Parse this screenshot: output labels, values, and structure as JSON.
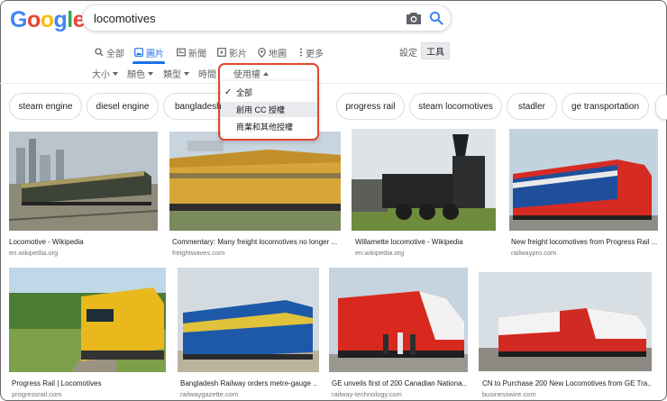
{
  "logo": "Google",
  "search": {
    "query": "locomotives"
  },
  "tabs": [
    {
      "label": "全部"
    },
    {
      "label": "圖片"
    },
    {
      "label": "新聞"
    },
    {
      "label": "影片"
    },
    {
      "label": "地圖"
    },
    {
      "label": "更多"
    }
  ],
  "settings_label": "設定",
  "tools_label": "工具",
  "filters": [
    {
      "label": "大小"
    },
    {
      "label": "顏色"
    },
    {
      "label": "類型"
    },
    {
      "label": "時間"
    },
    {
      "label": "使用權"
    }
  ],
  "usage_menu": [
    {
      "label": "全部",
      "checked": true
    },
    {
      "label": "創用 CC 授權",
      "highlighted": true
    },
    {
      "label": "商業和其他授權"
    }
  ],
  "chips": [
    "steam engine",
    "diesel engine",
    "bangladesh",
    "progress rail",
    "steam locomotives",
    "stadler",
    "ge transportation"
  ],
  "results_row1": [
    {
      "caption": "Locomotive - Wikipedia",
      "source": "en.wikipedia.org"
    },
    {
      "caption": "Commentary: Many freight locomotives no longer ...",
      "source": "freightwaves.com"
    },
    {
      "caption": "Willamette locomotive - Wikipedia",
      "source": "en.wikipedia.org"
    },
    {
      "caption": "New freight locomotives from Progress Rail ...",
      "source": "railwaypro.com"
    }
  ],
  "results_row2": [
    {
      "caption": "Progress Rail | Locomotives",
      "source": "progressrail.com"
    },
    {
      "caption": "Bangladesh Railway orders metre-gauge ...",
      "source": "railwaygazette.com"
    },
    {
      "caption": "GE unveils first of 200 Canadian Nationa...",
      "source": "railway-technology.com"
    },
    {
      "caption": "CN to Purchase 200 New Locomotives from GE Tra...",
      "source": "businesswire.com"
    }
  ],
  "colors": {
    "accent": "#1a73e8",
    "highlight_box": "#e2462f",
    "logo": [
      "#4285f4",
      "#ea4335",
      "#fbbc05",
      "#4285f4",
      "#34a853",
      "#ea4335"
    ]
  },
  "icons": [
    "camera-icon",
    "search-icon",
    "search-small-icon",
    "image-icon",
    "news-icon",
    "video-icon",
    "map-pin-icon",
    "more-vert-icon",
    "check-icon"
  ]
}
